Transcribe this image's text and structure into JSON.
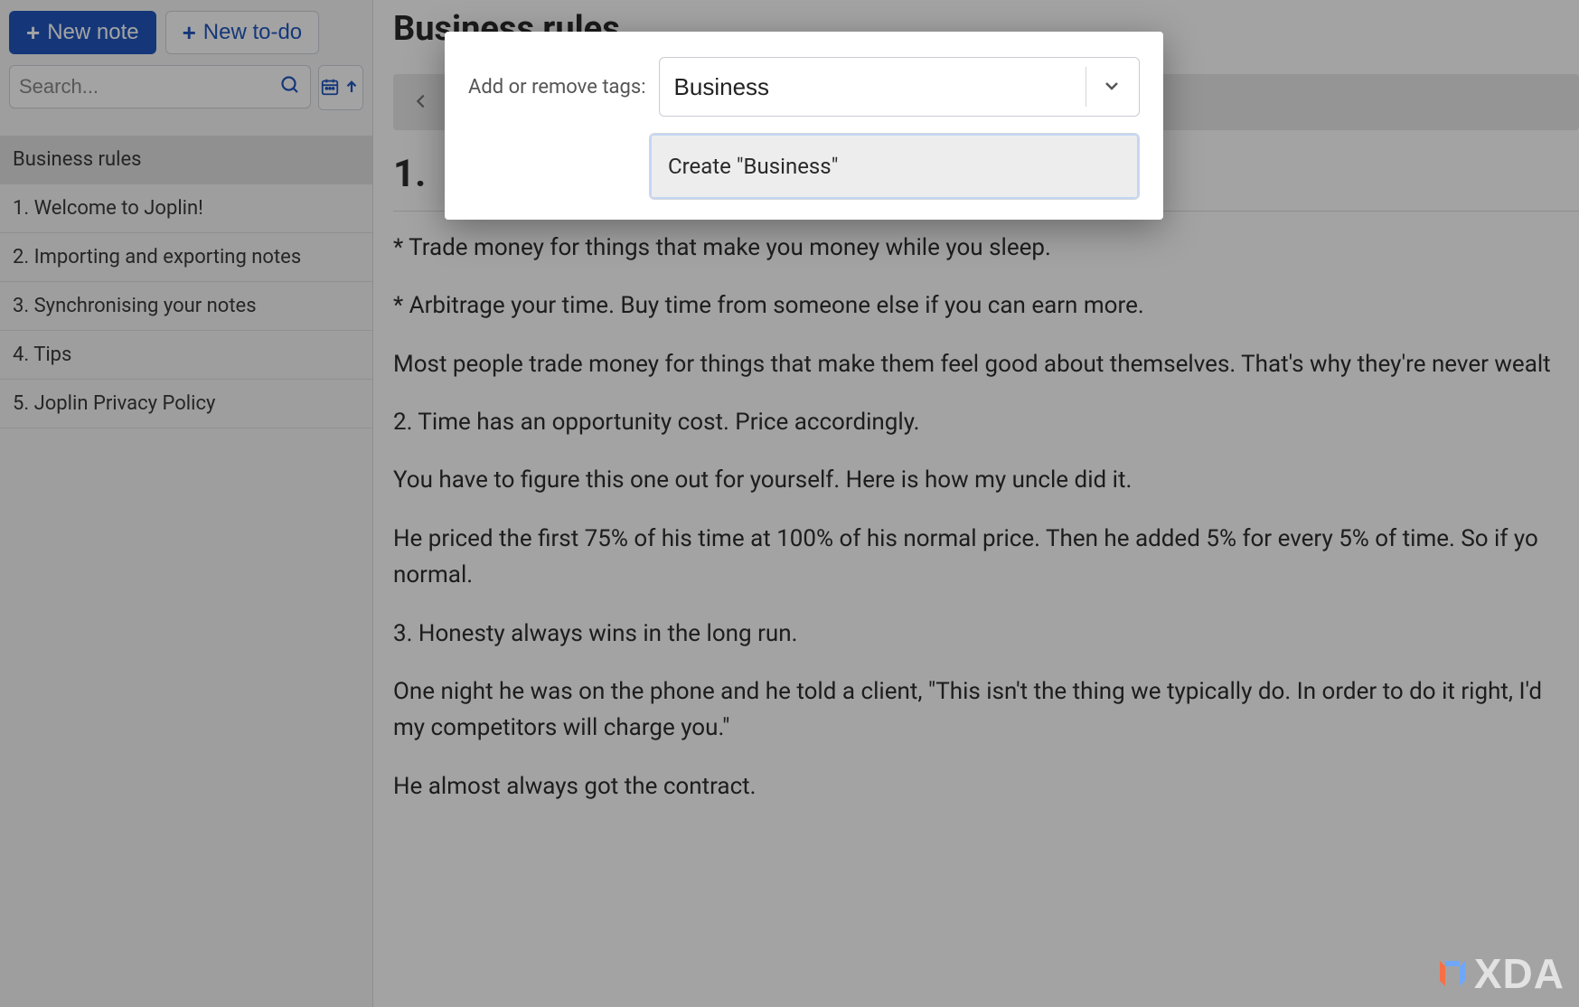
{
  "sidebar": {
    "new_note_label": "New note",
    "new_todo_label": "New to-do",
    "search_placeholder": "Search...",
    "notes": [
      {
        "label": "Business rules",
        "selected": true
      },
      {
        "label": "1. Welcome to Joplin!",
        "selected": false
      },
      {
        "label": "2. Importing and exporting notes",
        "selected": false
      },
      {
        "label": "3. Synchronising your notes",
        "selected": false
      },
      {
        "label": "4. Tips",
        "selected": false
      },
      {
        "label": "5. Joplin Privacy Policy",
        "selected": false
      }
    ]
  },
  "main": {
    "title": "Business rules",
    "heading_truncated": "1.",
    "paragraphs": [
      "* Trade money for things that make you money while you sleep.",
      "* Arbitrage your time. Buy time from someone else if you can earn more.",
      "Most people trade money for things that make them feel good about themselves. That's why they're never wealt",
      "2. Time has an opportunity cost. Price accordingly.",
      "You have to figure this one out for yourself. Here is how my uncle did it.",
      "He priced the first 75% of his time at 100% of his normal price. Then he added 5% for every 5% of time. So if yo",
      "normal.",
      "3. Honesty always wins in the long run.",
      "One night he was on the phone and he told a client, \"This isn't the thing we typically do. In order to do it right, I'd",
      "my competitors will charge you.\"",
      "He almost always got the contract."
    ]
  },
  "modal": {
    "label": "Add or remove tags:",
    "input_value": "Business",
    "dropdown_item": "Create \"Business\""
  },
  "watermark": {
    "text": "XDA"
  }
}
